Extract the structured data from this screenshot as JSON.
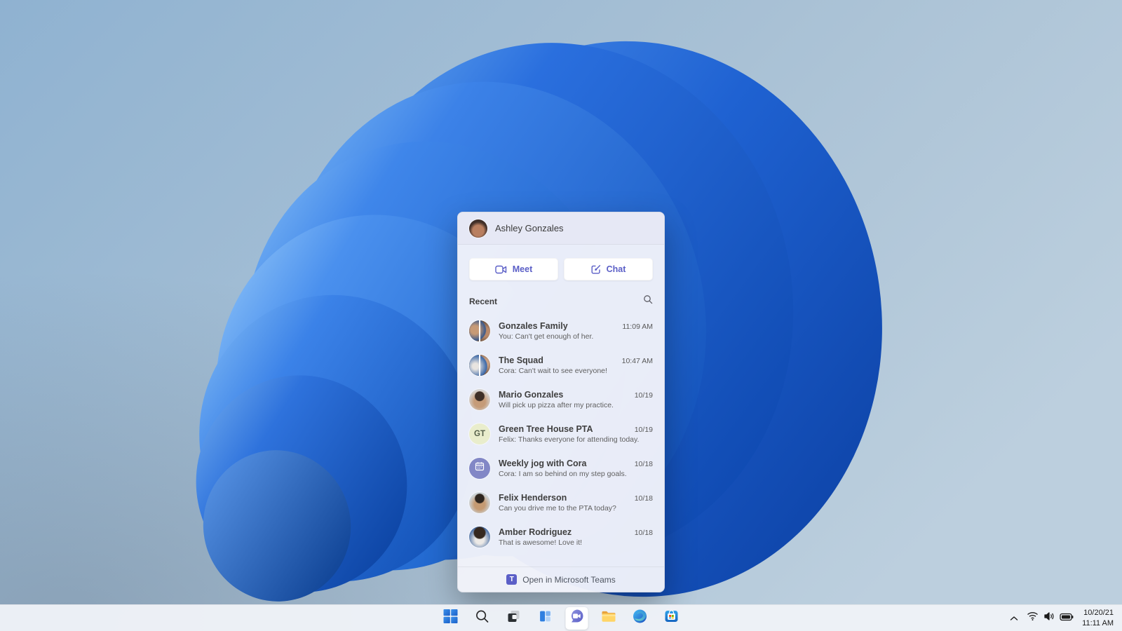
{
  "flyout": {
    "header": {
      "name": "Ashley Gonzales"
    },
    "actions": {
      "meet_label": "Meet",
      "chat_label": "Chat"
    },
    "recent_label": "Recent",
    "conversations": [
      {
        "name": "Gonzales Family",
        "preview": "You: Can't get enough of her.",
        "time": "11:09 AM"
      },
      {
        "name": "The Squad",
        "preview": "Cora: Can't wait to see everyone!",
        "time": "10:47 AM"
      },
      {
        "name": "Mario Gonzales",
        "preview": "Will pick up pizza after my practice.",
        "time": "10/19"
      },
      {
        "name": "Green Tree House PTA",
        "preview": "Felix: Thanks everyone for attending today.",
        "time": "10/19",
        "initials": "GT"
      },
      {
        "name": "Weekly jog with Cora",
        "preview": "Cora: I am so behind on my step goals.",
        "time": "10/18"
      },
      {
        "name": "Felix Henderson",
        "preview": "Can you drive me to the PTA today?",
        "time": "10/18"
      },
      {
        "name": "Amber Rodriguez",
        "preview": "That is awesome! Love it!",
        "time": "10/18"
      }
    ],
    "footer": {
      "label": "Open in Microsoft Teams",
      "logo_letter": "T"
    }
  },
  "taskbar": {
    "icons": [
      "start",
      "search",
      "task-view",
      "widgets",
      "teams-chat",
      "file-explorer",
      "edge",
      "microsoft-store"
    ],
    "active_icon": "teams-chat",
    "tray_icons": [
      "chevron-up",
      "wifi",
      "volume",
      "battery"
    ],
    "clock": {
      "date": "10/20/21",
      "time": "11:11 AM"
    }
  },
  "colors": {
    "teams_accent": "#5b5fc7",
    "panel_bg": "#f1f3fa",
    "taskbar_bg": "#eef2f7",
    "wallpaper_sky": "#8fb2d1",
    "bloom_deep_blue": "#0d47ae",
    "bloom_bright_blue": "#85c0f6"
  }
}
